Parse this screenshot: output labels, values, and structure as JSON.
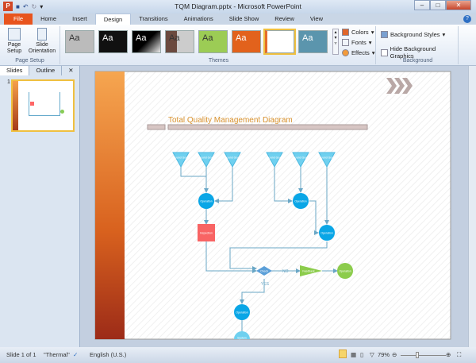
{
  "window": {
    "title": "TQM Diagram.pptx - Microsoft PowerPoint"
  },
  "tabs": [
    "File",
    "Home",
    "Insert",
    "Design",
    "Transitions",
    "Animations",
    "Slide Show",
    "Review",
    "View"
  ],
  "ribbon": {
    "page_setup": {
      "page_setup": "Page Setup",
      "slide_orientation": "Slide Orientation",
      "group": "Page Setup"
    },
    "themes": {
      "group": "Themes",
      "sample": "Aa"
    },
    "colors": "Colors",
    "fonts": "Fonts",
    "effects": "Effects",
    "background": {
      "styles": "Background Styles",
      "hide": "Hide Background Graphics",
      "group": "Background"
    }
  },
  "pane": {
    "tabs": [
      "Slides",
      "Outline"
    ],
    "close": "✕",
    "slide_number": "1"
  },
  "slide": {
    "title": "Total Quality Management Diagram",
    "inbound": "Inbound Goods",
    "operation": "Operation",
    "inspection": "Inspection",
    "check": "Check",
    "feedback": "Feedback",
    "system": "System",
    "no": "NO",
    "yes": "YES"
  },
  "status": {
    "slide": "Slide 1 of 1",
    "theme": "\"Thermal\"",
    "language": "English (U.S.)",
    "zoom": "79%"
  }
}
